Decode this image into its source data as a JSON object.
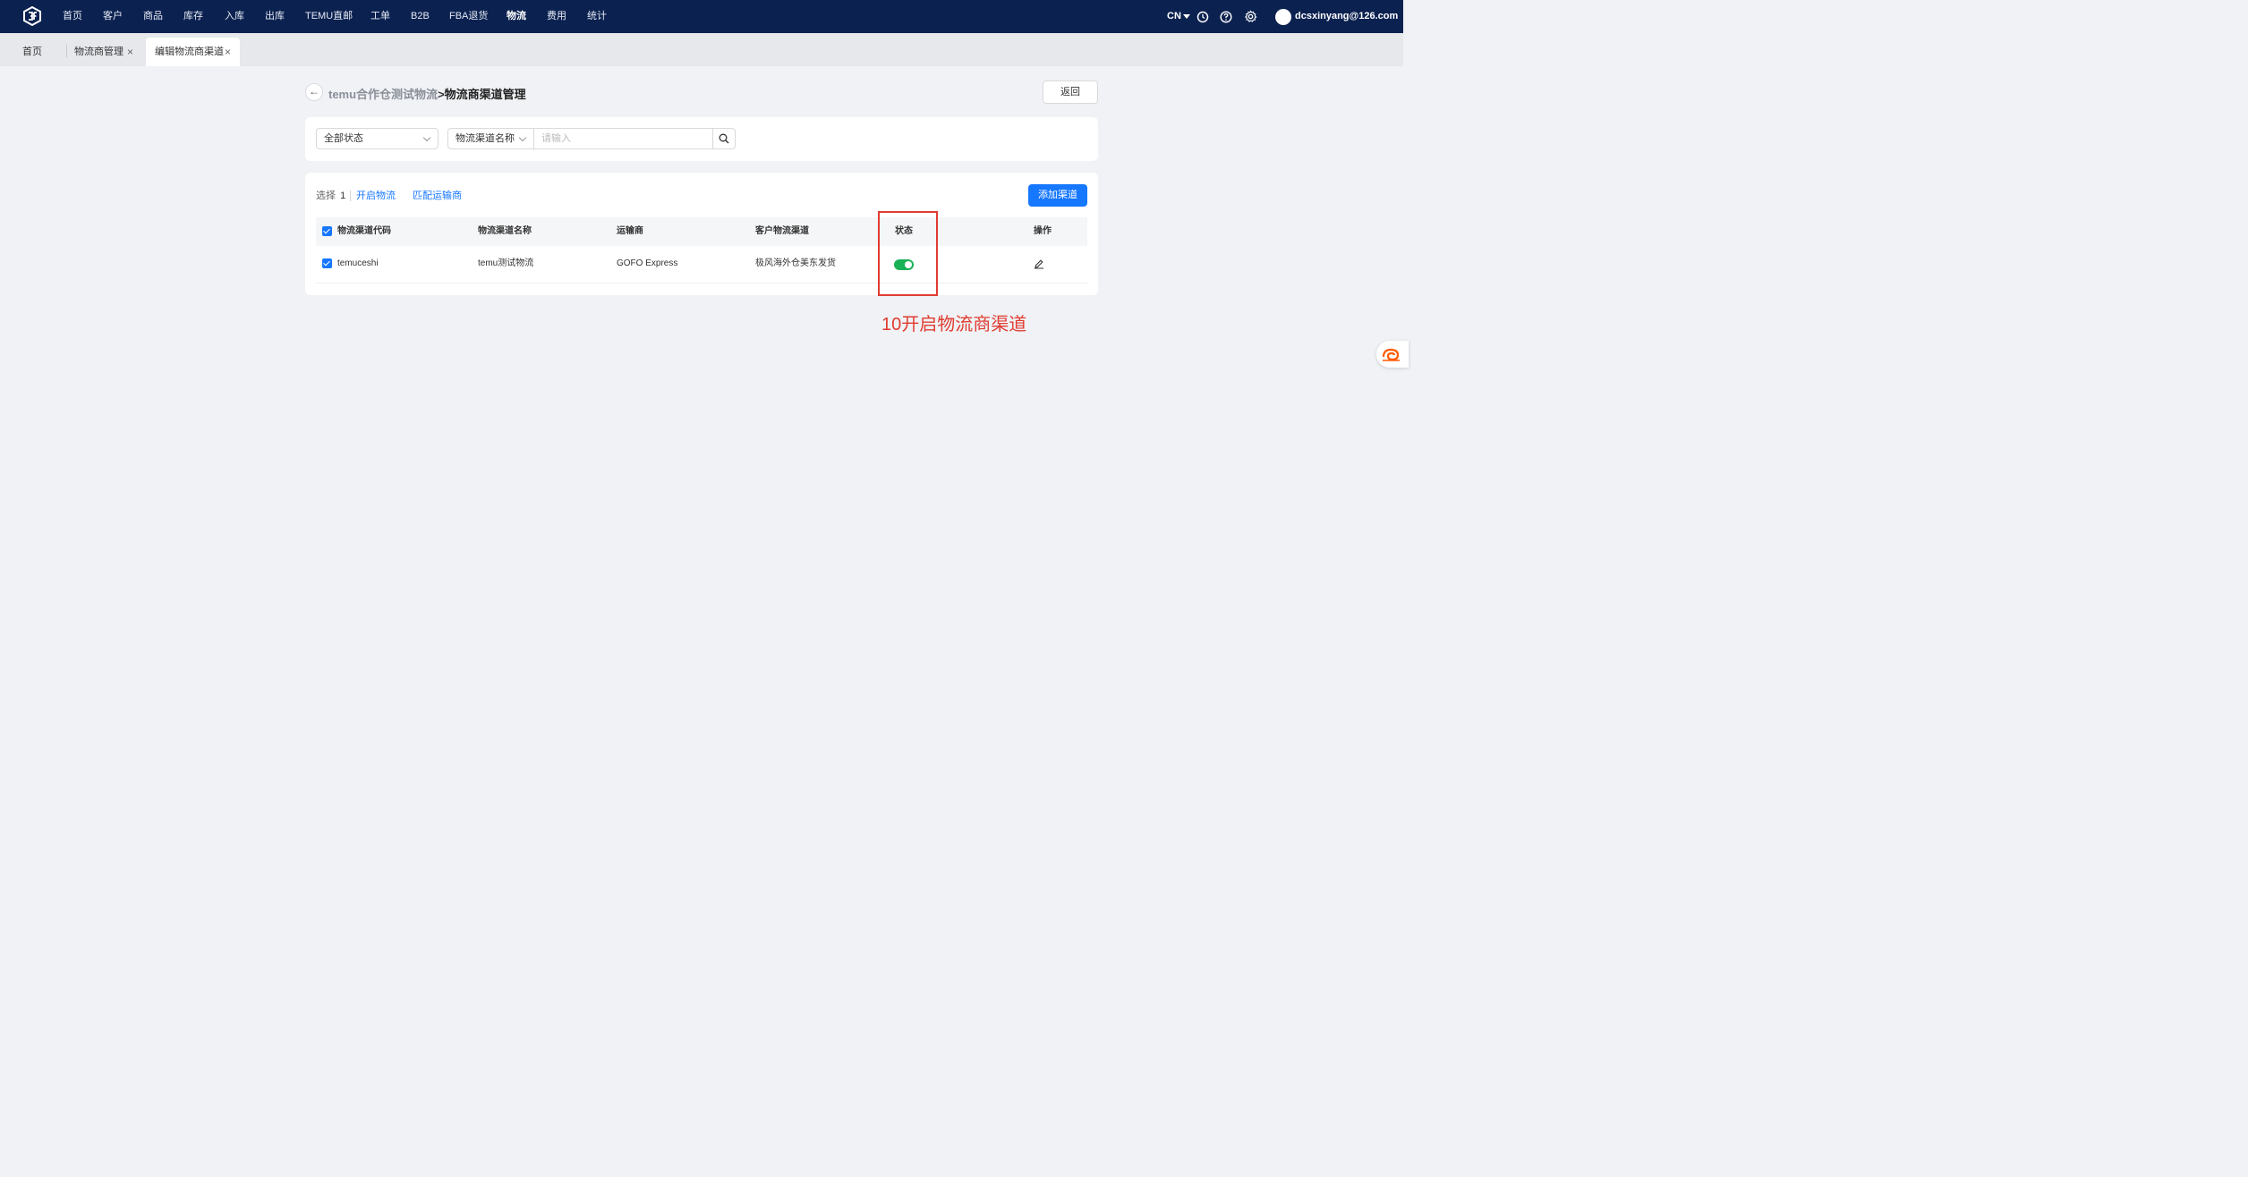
{
  "nav": {
    "items": [
      "首页",
      "客户",
      "商品",
      "库存",
      "入库",
      "出库",
      "TEMU直邮",
      "工单",
      "B2B",
      "FBA退货",
      "物流",
      "费用",
      "统计"
    ],
    "active": "物流",
    "lang": "CN",
    "user": "dcsxinyang@126.com"
  },
  "tabs": [
    {
      "label": "首页"
    },
    {
      "label": "物流商管理"
    },
    {
      "label": "编辑物流商渠道"
    }
  ],
  "page": {
    "breadcrumb_parent": "temu合作仓测试物流",
    "breadcrumb_sep": ">",
    "breadcrumb_current": "物流商渠道管理",
    "return_label": "返回"
  },
  "filter": {
    "status_select": "全部状态",
    "field_select": "物流渠道名称",
    "search_placeholder": "请输入"
  },
  "toolbar": {
    "selected_label": "选择",
    "selected_count": "1",
    "enable_label": "开启物流",
    "match_label": "匹配运输商",
    "add_label": "添加渠道"
  },
  "table": {
    "columns": [
      "物流渠道代码",
      "物流渠道名称",
      "运输商",
      "客户物流渠道",
      "状态",
      "操作"
    ],
    "rows": [
      {
        "code": "temuceshi",
        "name": "temu测试物流",
        "carrier": "GOFO Express",
        "customer_channel": "极风海外仓美东发货",
        "status_on": true
      }
    ]
  },
  "annotation": {
    "text": "10开启物流商渠道",
    "color": "#e03c31"
  },
  "colors": {
    "nav_bg": "#0b2150",
    "primary": "#1677ff",
    "toggle_on": "#18b155"
  }
}
